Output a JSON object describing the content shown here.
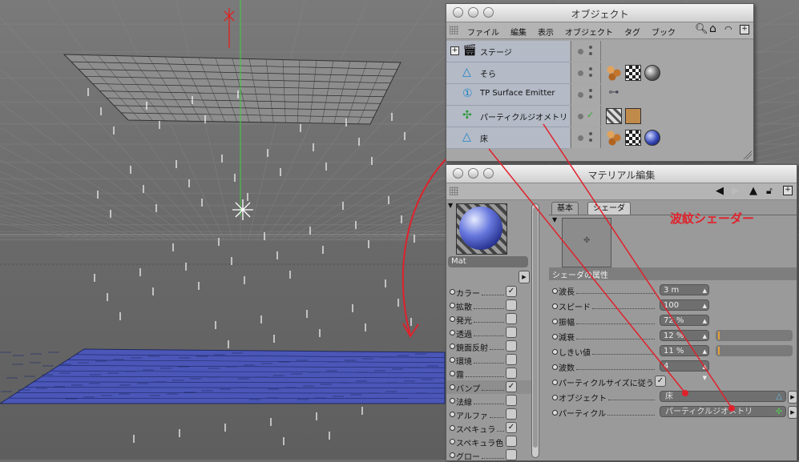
{
  "object_window": {
    "title": "オブジェクト",
    "menu": [
      "ファイル",
      "編集",
      "表示",
      "オブジェクト",
      "タグ",
      "ブック"
    ],
    "objects": [
      {
        "name": "ステージ",
        "icon": "stage-icon"
      },
      {
        "name": "そら",
        "icon": "sky-icon"
      },
      {
        "name": "TP Surface Emitter",
        "icon": "emitter-icon"
      },
      {
        "name": "パーティクルジオメトリ",
        "icon": "particle-geometry-icon"
      },
      {
        "name": "床",
        "icon": "floor-icon"
      }
    ]
  },
  "material_window": {
    "title": "マテリアル編集",
    "material_name": "Mat",
    "tabs": [
      "基本",
      "シェーダ"
    ],
    "active_tab": "シェーダ",
    "channels": [
      {
        "label": "カラー",
        "checked": true
      },
      {
        "label": "拡散",
        "checked": false
      },
      {
        "label": "発光",
        "checked": false
      },
      {
        "label": "透過",
        "checked": false
      },
      {
        "label": "鏡面反射",
        "checked": false
      },
      {
        "label": "環境",
        "checked": false
      },
      {
        "label": "霧",
        "checked": false
      },
      {
        "label": "バンプ",
        "checked": true
      },
      {
        "label": "法線",
        "checked": false
      },
      {
        "label": "アルファ",
        "checked": false
      },
      {
        "label": "スペキュラ",
        "checked": true
      },
      {
        "label": "スペキュラ色",
        "checked": false
      },
      {
        "label": "グロー",
        "checked": false
      }
    ],
    "section_title": "シェーダの属性",
    "attributes": [
      {
        "label": "波長",
        "value": "3 m"
      },
      {
        "label": "スピード",
        "value": "100"
      },
      {
        "label": "振幅",
        "value": "72 %"
      },
      {
        "label": "減衰",
        "value": "12 %",
        "slider_level": 0.12
      },
      {
        "label": "しきい値",
        "value": "11 %",
        "slider_level": 0.11
      },
      {
        "label": "波数",
        "value": "4"
      }
    ],
    "checkbox_attr": {
      "label": "パーティクルサイズに従う",
      "checked": true
    },
    "link_attrs": [
      {
        "label": "オブジェクト",
        "value": "床"
      },
      {
        "label": "パーティクル",
        "value": "パーティクルジオメトリ"
      }
    ]
  },
  "annotation": "波紋シェーダー",
  "colors": {
    "annotation": "#e0212b",
    "floor": "#4a57b8",
    "row_highlight": "#b4bac6"
  }
}
